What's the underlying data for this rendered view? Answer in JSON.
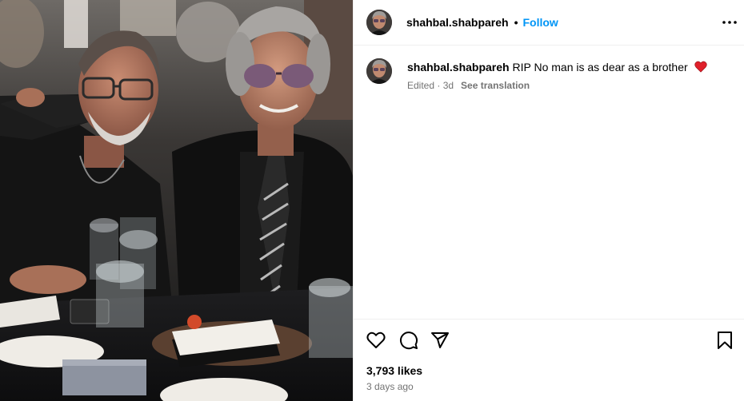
{
  "post": {
    "username": "shahbal.shabpareh",
    "follow_label": "Follow",
    "separator": "•",
    "caption_text": "RIP No man is as dear as a brother",
    "caption_emoji": "red-heart",
    "edited_label": "Edited · 3d",
    "see_translation_label": "See translation",
    "likes_label": "3,793 likes",
    "posted_ago": "3 days ago"
  },
  "icons": {
    "more": "more-horizontal-icon",
    "like": "heart-outline-icon",
    "comment": "comment-bubble-icon",
    "share": "paper-plane-icon",
    "save": "bookmark-icon"
  },
  "colors": {
    "follow_blue": "#0095f6",
    "secondary_text": "#737373",
    "divider": "#efefef",
    "heart_red": "#e0202b"
  }
}
